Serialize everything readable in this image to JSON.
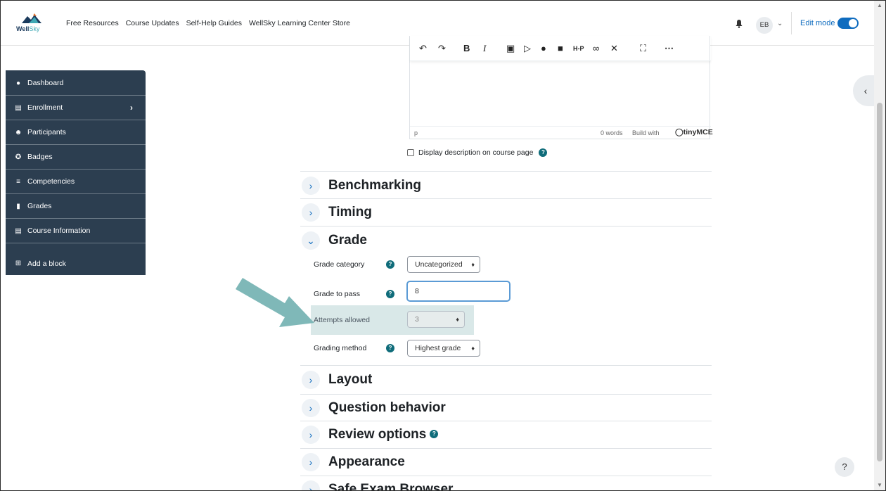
{
  "brand": {
    "name_a": "Well",
    "name_b": "Sky"
  },
  "nav": {
    "links": [
      "Free Resources",
      "Course Updates",
      "Self-Help Guides",
      "WellSky Learning Center Store"
    ],
    "avatar_initials": "EB",
    "edit_mode_label": "Edit mode",
    "edit_mode_on": true
  },
  "drawer": {
    "items": [
      {
        "label": "Dashboard",
        "icon": "dashboard-icon"
      },
      {
        "label": "Enrollment",
        "icon": "institution-icon"
      },
      {
        "label": "Participants",
        "icon": "users-icon"
      },
      {
        "label": "Badges",
        "icon": "badge-icon"
      },
      {
        "label": "Competencies",
        "icon": "list-icon"
      },
      {
        "label": "Grades",
        "icon": "clipboard-icon"
      },
      {
        "label": "Course Information",
        "icon": "info-list-icon"
      },
      {
        "label": "Add a block",
        "icon": "plus-square-icon"
      }
    ]
  },
  "editor": {
    "status_path": "p",
    "word_count": "0 words",
    "build_with": "Build with",
    "brand": "tinyMCE"
  },
  "description": {
    "display_label": "Display description on course page"
  },
  "sections": {
    "benchmarking": "Benchmarking",
    "timing": "Timing",
    "grade": "Grade",
    "layout": "Layout",
    "question_behavior": "Question behavior",
    "review_options": "Review options",
    "appearance": "Appearance",
    "safe_exam": "Safe Exam Browser"
  },
  "grade_form": {
    "grade_category_label": "Grade category",
    "grade_category_value": "Uncategorized",
    "grade_to_pass_label": "Grade to pass",
    "grade_to_pass_value": "8",
    "attempts_label": "Attempts allowed",
    "attempts_value": "3",
    "grading_method_label": "Grading method",
    "grading_method_value": "Highest grade"
  },
  "colors": {
    "accent": "#0f6cbf",
    "drawer_bg": "#2c3e50",
    "highlight": "#d9e8e8",
    "arrow": "#7fb8b8"
  }
}
